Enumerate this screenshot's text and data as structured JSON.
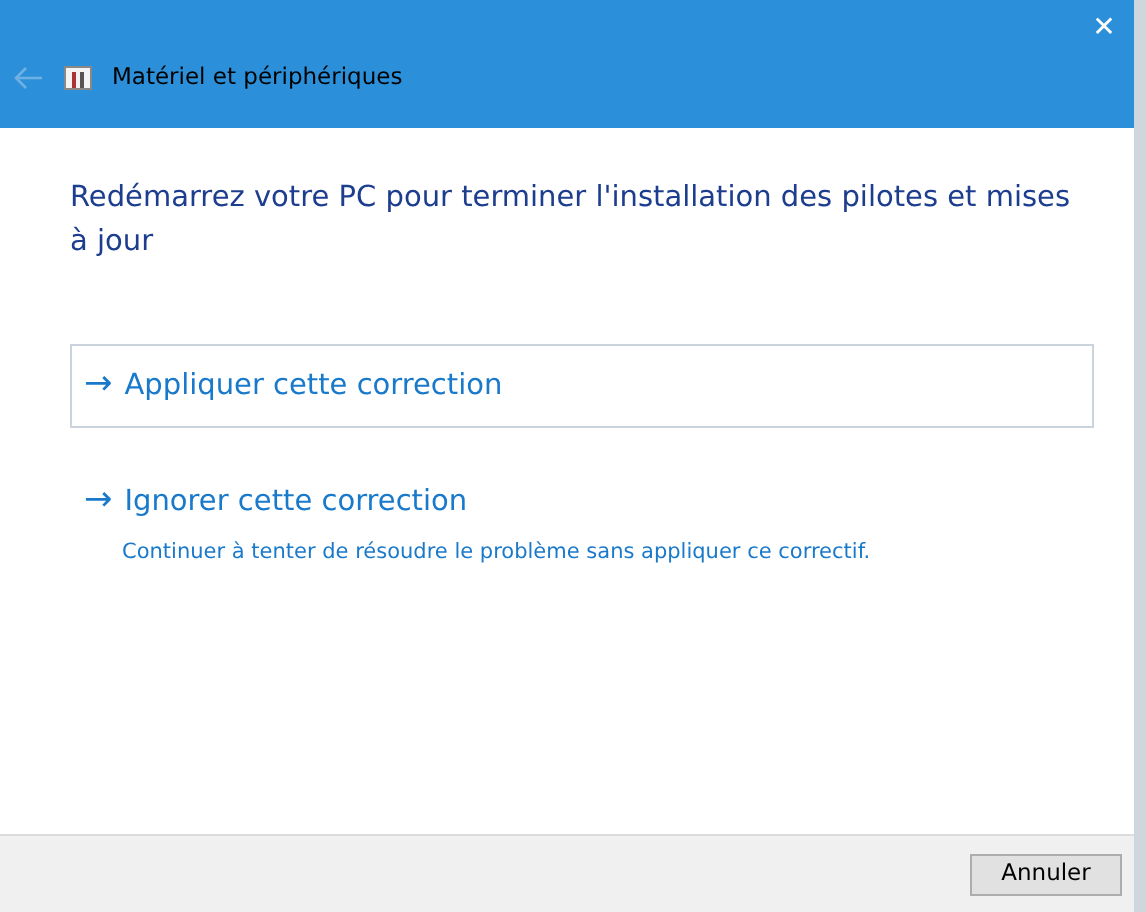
{
  "window": {
    "title": "Matériel et périphériques",
    "close": "✕"
  },
  "heading": "Redémarrez votre PC pour terminer l'installation des pilotes et mises à jour",
  "options": [
    {
      "arrow": "→",
      "label": "Appliquer cette correction",
      "selected": true
    },
    {
      "arrow": "→",
      "label": "Ignorer cette correction",
      "description": "Continuer à tenter de résoudre le problème sans appliquer ce correctif.",
      "selected": false
    }
  ],
  "buttons": [
    "Annuler"
  ]
}
